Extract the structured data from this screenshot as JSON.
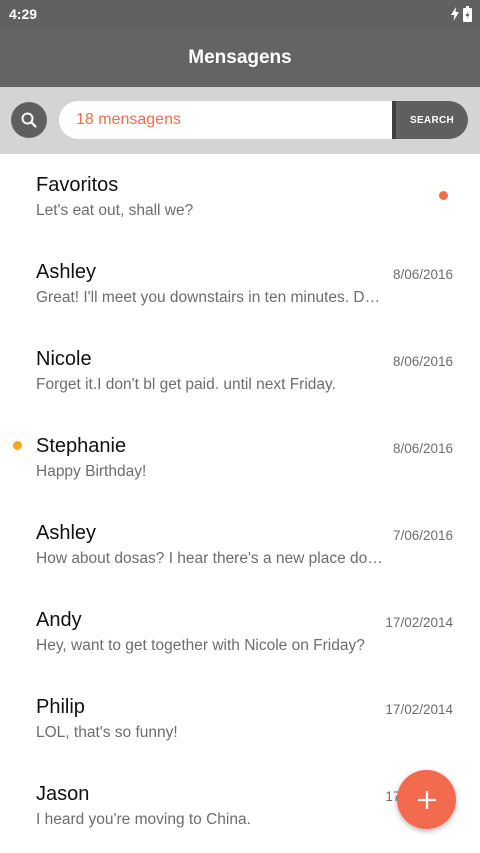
{
  "status_bar": {
    "time": "4:29"
  },
  "app_bar": {
    "title": "Mensagens"
  },
  "search": {
    "placeholder": "18 mensagens",
    "button_label": "SEARCH"
  },
  "colors": {
    "accent": "#f26b4f",
    "unread_orange": "#f5a623",
    "bar": "#646464"
  },
  "messages": [
    {
      "name": "Favoritos",
      "preview": "Let's eat out, shall we?",
      "date": "",
      "indicator": "right-dot"
    },
    {
      "name": "Ashley",
      "preview": "Great! I'll meet you downstairs in ten minutes. Don't be late!",
      "date": "8/06/2016",
      "indicator": ""
    },
    {
      "name": "Nicole",
      "preview": "Forget it.I don't bl get paid. until next Friday.",
      "date": "8/06/2016",
      "indicator": ""
    },
    {
      "name": "Stephanie",
      "preview": "Happy Birthday!",
      "date": "8/06/2016",
      "indicator": "left-dot"
    },
    {
      "name": "Ashley",
      "preview": "How about dosas? I hear there's a new place downtown.",
      "date": "7/06/2016",
      "indicator": ""
    },
    {
      "name": "Andy",
      "preview": "Hey, want to get together with Nicole on Friday?",
      "date": "17/02/2014",
      "indicator": ""
    },
    {
      "name": "Philip",
      "preview": "LOL, that's so funny!",
      "date": "17/02/2014",
      "indicator": ""
    },
    {
      "name": "Jason",
      "preview": "I heard you're moving to China.",
      "date": "17/02/2014",
      "indicator": ""
    }
  ]
}
